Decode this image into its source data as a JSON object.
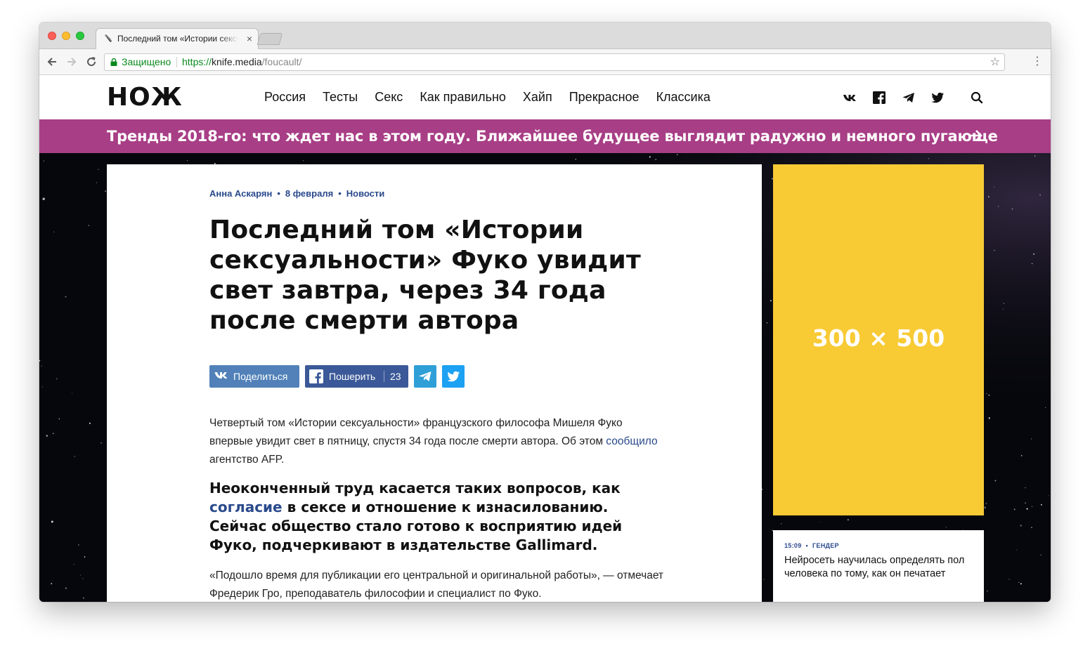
{
  "browser": {
    "tab_title": "Последний том «Истории сексуальности» Фуко",
    "tab_close": "×",
    "secure_label": "Защищено",
    "url_scheme": "https://",
    "url_host": "knife.media",
    "url_path": "/foucault/"
  },
  "header": {
    "logo": "НОЖ",
    "nav": [
      "Россия",
      "Тесты",
      "Секс",
      "Как правильно",
      "Хайп",
      "Прекрасное",
      "Классика"
    ]
  },
  "promo": {
    "text": "Тренды 2018-го: что ждет нас в этом году. Ближайшее будущее выглядит радужно и немного пугающе"
  },
  "article": {
    "author": "Анна Аскарян",
    "date": "8 февраля",
    "category": "Новости",
    "title": "Последний том «Истории сексуальности» Фуко увидит свет завтра, через 34 года после смерти автора",
    "share": {
      "vk_label": "Поделиться",
      "fb_label": "Пошерить",
      "fb_count": "23"
    },
    "lead_1": "Четвертый том «Истории сексуальности» французского философа Мишеля Фуко впервые увидит свет в пятницу, спустя 34 года после смерти автора. Об этом ",
    "lead_link": "сообщило",
    "lead_2": " агентство AFP.",
    "quote_1": "Неоконченный труд касается таких вопросов, как ",
    "quote_link": "согласие",
    "quote_2": " в сексе и отношение к изнасилованию. Сейчас общество стало готово к восприятию идей Фуко, подчеркивают в издательстве Gallimard.",
    "para": "«Подошло время для публикации его центральной и оригинальной работы», — отмечает Фредерик Гро, преподаватель философии и специалист по Фуко."
  },
  "sidebar": {
    "ad_label": "300 × 500",
    "news": {
      "time": "15:09",
      "tag": "ГЕНДЕР",
      "title": "Нейросеть научилась определять пол человека по тому, как он печатает"
    }
  },
  "colors": {
    "promo_bg": "#a83e86",
    "ad_bg": "#f8ca34",
    "link": "#2a4a8c",
    "vk": "#5181b8",
    "facebook": "#3b5998",
    "telegram": "#2f9fd8",
    "twitter": "#1da1f2"
  },
  "icons": [
    "back-icon",
    "forward-icon",
    "reload-icon",
    "lock-icon",
    "star-icon",
    "menu-icon",
    "vk-icon",
    "facebook-icon",
    "telegram-icon",
    "twitter-icon",
    "search-icon",
    "arrow-right-icon",
    "knife-favicon-icon"
  ]
}
